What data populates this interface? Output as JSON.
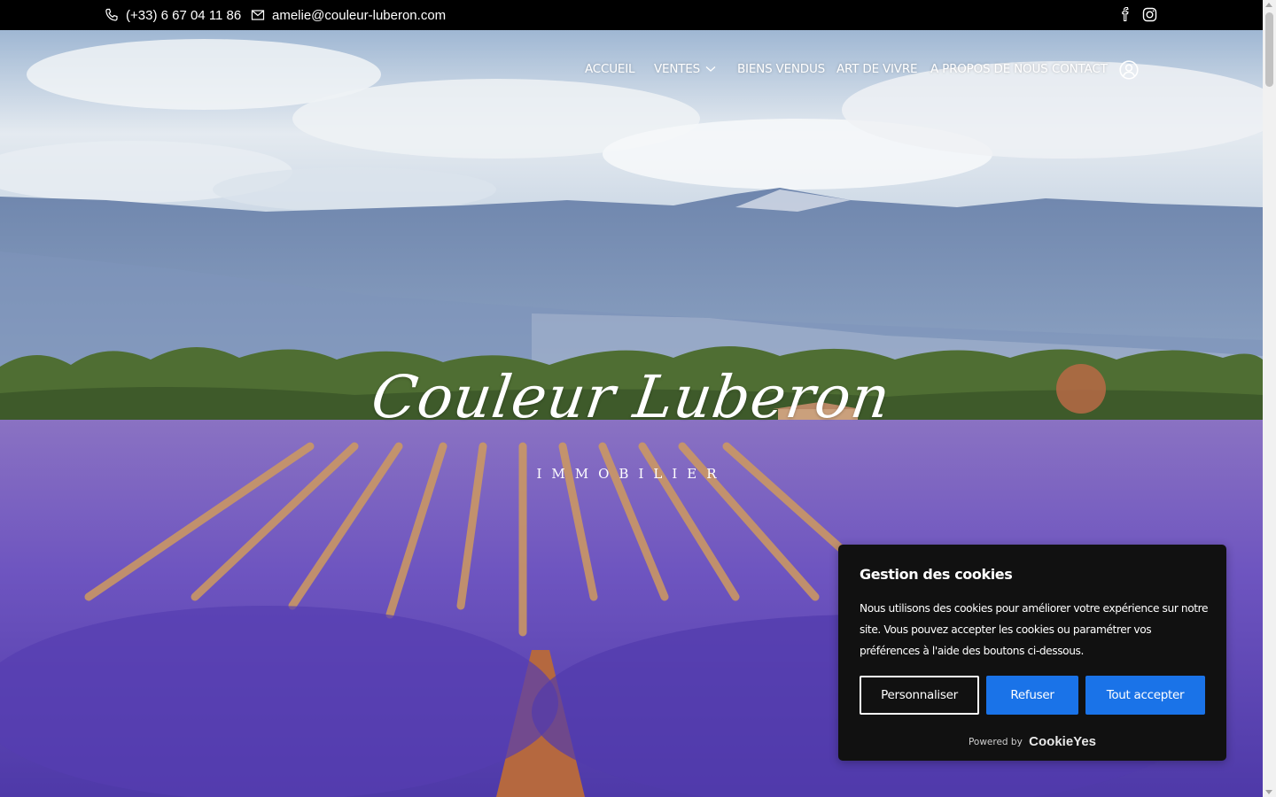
{
  "topbar": {
    "phone": "(+33) 6 67 04 11 86",
    "email": "amelie@couleur-luberon.com",
    "social": [
      "facebook-icon",
      "instagram-icon"
    ]
  },
  "nav": {
    "items": [
      "ACCUEIL",
      "VENTES",
      "BIENS VENDUS",
      "ART DE VIVRE",
      "A PROPOS DE NOUS",
      "CONTACT"
    ]
  },
  "hero": {
    "logo_script": "Couleur Luberon",
    "logo_sub": "IMMOBILIER"
  },
  "cookie": {
    "title": "Gestion des cookies",
    "body": "Nous utilisons des cookies pour améliorer votre expérience sur notre site. Vous pouvez accepter les cookies ou paramétrer vos préférences à l'aide des boutons ci-dessous.",
    "personalize": "Personnaliser",
    "refuse": "Refuser",
    "accept_all": "Tout accepter",
    "powered_by": "Powered by",
    "brand": "CookieYes",
    "button_color": "#1a73e8"
  }
}
